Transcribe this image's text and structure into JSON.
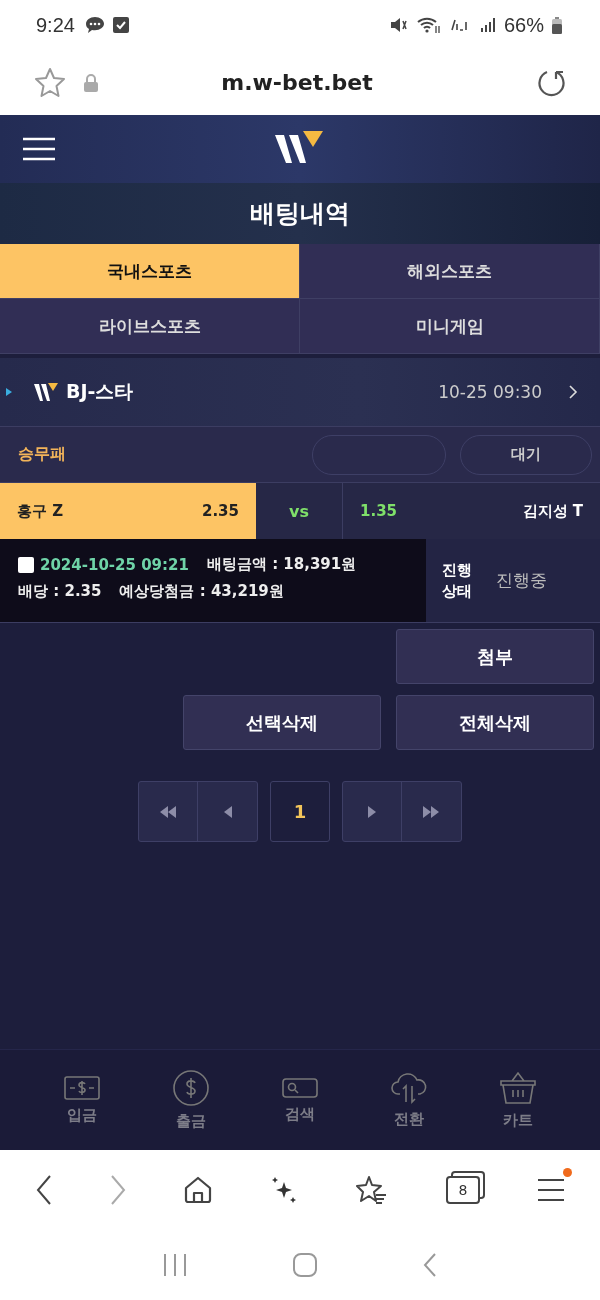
{
  "status_bar": {
    "time": "9:24",
    "battery": "66%"
  },
  "browser": {
    "url": "m.w-bet.bet",
    "tab_count": "8",
    "menu_badge": true
  },
  "page_title": "배팅내역",
  "tabs": [
    {
      "label": "국내스포츠",
      "selected": true
    },
    {
      "label": "해외스포츠",
      "selected": false
    },
    {
      "label": "라이브스포츠",
      "selected": false
    },
    {
      "label": "미니게임",
      "selected": false
    }
  ],
  "bet": {
    "league": "BJ-스타",
    "time": "10-25 09:30",
    "market": "승무패",
    "result_pill": "대기",
    "home": {
      "name": "홍구 Z",
      "odds": "2.35",
      "selected": true
    },
    "vs": "vs",
    "away": {
      "name": "김지성 T",
      "odds": "1.35",
      "selected": false
    },
    "checked": false,
    "placed_at": "2024-10-25 09:21",
    "stake": "배팅금액 : 18,391원",
    "odds": "배당 : 2.35",
    "payout": "예상당첨금 : 43,219원",
    "status_label": "진행 상태",
    "status": "진행중"
  },
  "actions": [
    "첨부",
    "선택삭제",
    "전체삭제"
  ],
  "pagination": [
    {
      "label": "1",
      "selected": true
    }
  ],
  "bottom_nav": [
    {
      "kind": "deposit",
      "label": "입금"
    },
    {
      "kind": "withdraw",
      "label": "출금"
    },
    {
      "kind": "search",
      "label": "검색"
    },
    {
      "kind": "switch",
      "label": "전환"
    },
    {
      "kind": "cart",
      "label": "카트"
    }
  ]
}
